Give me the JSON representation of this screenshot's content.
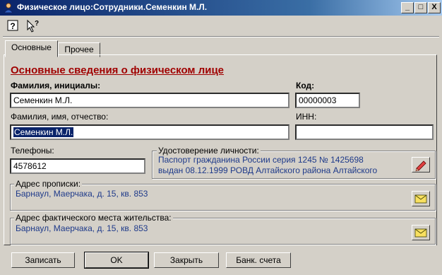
{
  "window": {
    "title": "Физическое лицо:Сотрудники.Семенкин М.Л.",
    "minimize": "_",
    "maximize": "□",
    "close": "X"
  },
  "toolbar": {
    "help_icon": "help-icon",
    "whats_this_icon": "whats-this-icon"
  },
  "tabs": [
    {
      "label": "Основные",
      "active": true
    },
    {
      "label": "Прочее",
      "active": false
    }
  ],
  "section_title": "Основные сведения о физическом лице",
  "form": {
    "short_name_label": "Фамилия, инициалы:",
    "short_name_value": "Семенкин М.Л.",
    "code_label": "Код:",
    "code_value": "00000003",
    "full_name_label": "Фамилия, имя, отчество:",
    "full_name_value": "Семенкин М.Л.",
    "inn_label": "ИНН:",
    "inn_value": "",
    "phones_label": "Телефоны:",
    "phones_value": "4578612",
    "id_doc_label": "Удостоверение личности:",
    "id_doc_line1": "Паспорт гражданина России серия 1245 № 1425698",
    "id_doc_line2": "выдан 08.12.1999 РОВД Алтайского района Алтайского",
    "reg_address_label": "Адрес прописки:",
    "reg_address_value": "Барнаул, Маерчака, д. 15, кв. 853",
    "actual_address_label": "Адрес фактического места жительства:",
    "actual_address_value": "Барнаул, Маерчака, д. 15, кв. 853"
  },
  "buttons": {
    "save": "Записать",
    "ok": "OK",
    "close": "Закрыть",
    "bank": "Банк. счета"
  },
  "colors": {
    "title_gradient_start": "#0a246a",
    "section_title": "#a00000",
    "link_text": "#1e3a8a",
    "selection": "#0a246a"
  }
}
